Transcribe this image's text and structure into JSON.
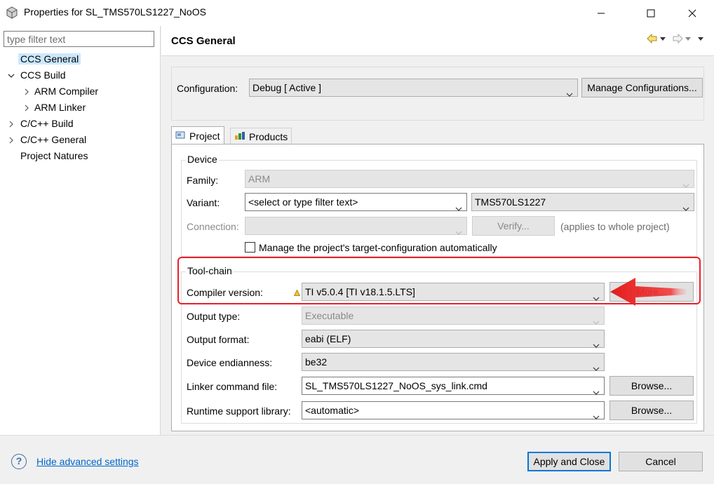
{
  "window": {
    "title": "Properties for SL_TMS570LS1227_NoOS"
  },
  "left_pane": {
    "filter_placeholder": "type filter text",
    "tree": [
      {
        "label": "CCS General",
        "level": 0,
        "selected": true
      },
      {
        "label": "CCS Build",
        "level": 0,
        "expanded": true
      },
      {
        "label": "ARM Compiler",
        "level": 1
      },
      {
        "label": "ARM Linker",
        "level": 1
      },
      {
        "label": "C/C++ Build",
        "level": 0
      },
      {
        "label": "C/C++ General",
        "level": 0
      },
      {
        "label": "Project Natures",
        "level": 0
      }
    ]
  },
  "page": {
    "title": "CCS General",
    "configuration_label": "Configuration:",
    "configuration_value": "Debug  [ Active ]",
    "manage_configurations": "Manage Configurations...",
    "tabs": [
      {
        "label": "Project",
        "icon": "project-icon",
        "active": true
      },
      {
        "label": "Products",
        "icon": "products-icon",
        "active": false
      }
    ],
    "device": {
      "group_title": "Device",
      "family_label": "Family:",
      "family_value": "ARM",
      "variant_label": "Variant:",
      "variant_filter": "<select or type filter text>",
      "variant_value": "TMS570LS1227",
      "connection_label": "Connection:",
      "verify_button": "Verify...",
      "applies_note": "(applies to whole project)",
      "manage_checkbox_label": "Manage the project's target-configuration automatically"
    },
    "toolchain": {
      "group_title": "Tool-chain",
      "compiler_label": "Compiler version:",
      "compiler_value": "TI v5.0.4  [TI v18.1.5.LTS]",
      "more_button": "More...",
      "output_type_label": "Output type:",
      "output_type_value": "Executable",
      "output_format_label": "Output format:",
      "output_format_value": "eabi (ELF)",
      "endianness_label": "Device endianness:",
      "endianness_value": "be32",
      "linker_label": "Linker command file:",
      "linker_value": "SL_TMS570LS1227_NoOS_sys_link.cmd",
      "browse_label": "Browse...",
      "runtime_label": "Runtime support library:",
      "runtime_value": "<automatic>"
    }
  },
  "footer": {
    "hide_advanced": "Hide advanced settings",
    "apply_close": "Apply and Close",
    "cancel": "Cancel"
  },
  "colors": {
    "highlight": "#e8202a",
    "selection": "#cce8ff",
    "primary_border": "#0078d7",
    "link": "#0066cc"
  }
}
